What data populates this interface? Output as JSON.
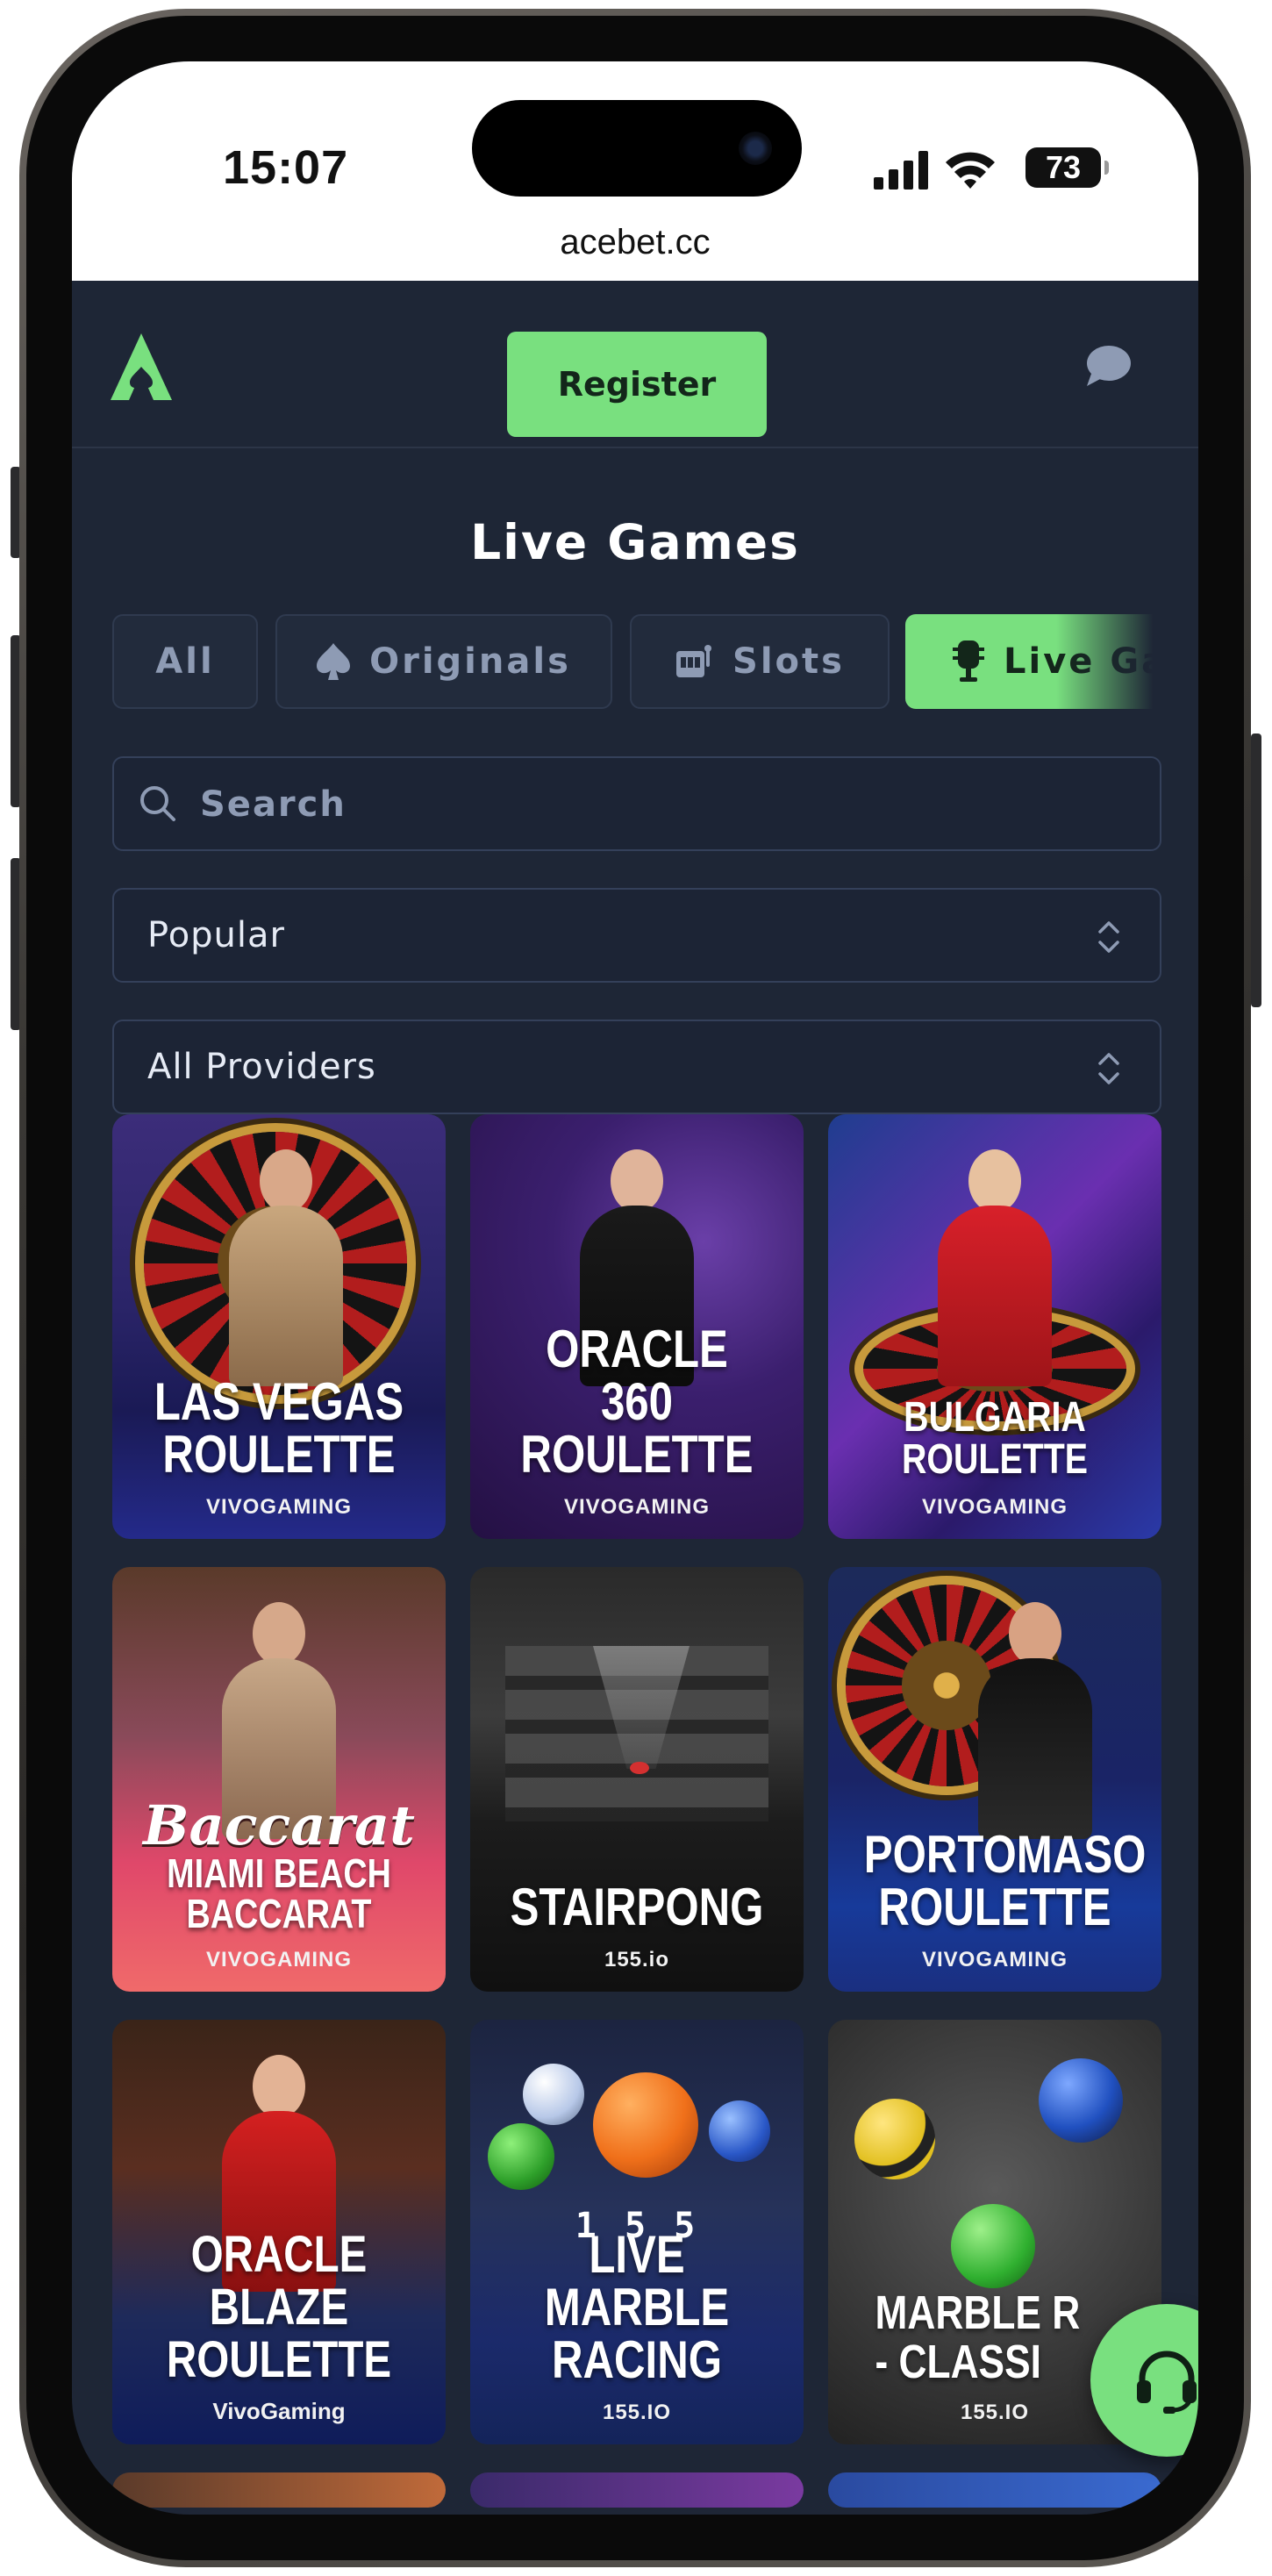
{
  "status_bar": {
    "time": "15:07",
    "battery": "73"
  },
  "browser": {
    "url": "acebet.cc"
  },
  "header": {
    "register_label": "Register"
  },
  "page": {
    "title": "Live Games"
  },
  "tabs": [
    {
      "label": "All",
      "icon": "none"
    },
    {
      "label": "Originals",
      "icon": "spade-icon"
    },
    {
      "label": "Slots",
      "icon": "slot-machine-icon"
    },
    {
      "label": "Live Games",
      "icon": "microphone-icon",
      "active": true
    }
  ],
  "search": {
    "placeholder": "Search",
    "value": ""
  },
  "filters": {
    "sort_selected": "Popular",
    "provider_selected": "All Providers"
  },
  "games": [
    {
      "title": "LAS VEGAS\nROULETTE",
      "provider": "VIVOGAMING"
    },
    {
      "title": "ORACLE 360\nROULETTE",
      "provider": "VIVOGAMING"
    },
    {
      "title": "BULGARIA\nROULETTE",
      "provider": "VIVOGAMING"
    },
    {
      "title": "MIAMI BEACH\nBACCARAT",
      "provider": "VIVOGAMING",
      "script": "Baccarat"
    },
    {
      "title": "STAIRPONG",
      "provider": "155.io"
    },
    {
      "title": "PORTOMASO\nROULETTE",
      "provider": "VIVOGAMING"
    },
    {
      "title": "ORACLE BLAZE\nROULETTE",
      "provider": "VivoGaming"
    },
    {
      "title": "LIVE MARBLE\nRACING",
      "provider": "155.IO",
      "counter": "1 5 5"
    },
    {
      "title": "MARBLE R\n- CLASSI",
      "provider": "155.IO"
    }
  ],
  "colors": {
    "accent": "#79e07f",
    "background": "#1e2636",
    "tab_text": "#8e9bb4"
  }
}
